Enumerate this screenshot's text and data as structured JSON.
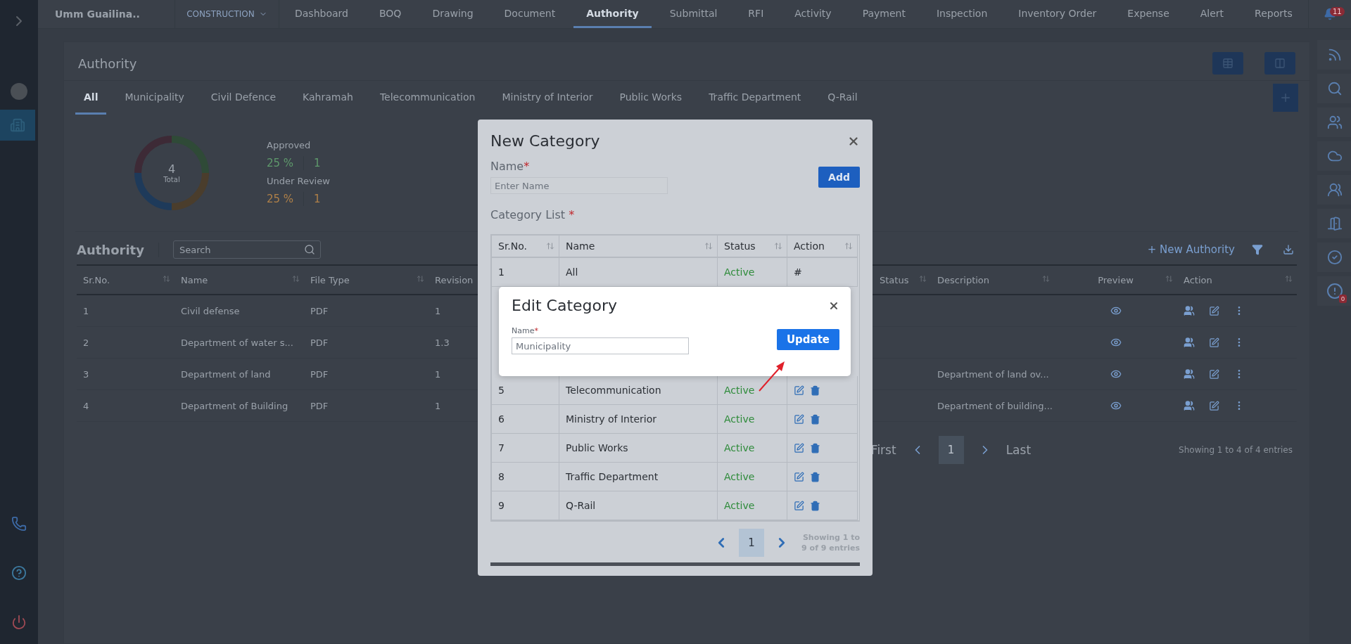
{
  "topbar": {
    "project": "Umm Guailina..",
    "module": "CONSTRUCTION",
    "nav": [
      {
        "label": "Dashboard",
        "selected": false
      },
      {
        "label": "BOQ",
        "selected": false
      },
      {
        "label": "Drawing",
        "selected": false
      },
      {
        "label": "Document",
        "selected": false
      },
      {
        "label": "Authority",
        "selected": true
      },
      {
        "label": "Submittal",
        "selected": false
      },
      {
        "label": "RFI",
        "selected": false
      },
      {
        "label": "Activity",
        "selected": false
      },
      {
        "label": "Payment",
        "selected": false
      },
      {
        "label": "Inspection",
        "selected": false
      },
      {
        "label": "Inventory Order",
        "selected": false
      },
      {
        "label": "Expense",
        "selected": false
      },
      {
        "label": "Alert",
        "selected": false
      },
      {
        "label": "Reports",
        "selected": false
      }
    ],
    "notifications": "11"
  },
  "page": {
    "title": "Authority",
    "tabs": [
      {
        "label": "All",
        "selected": true
      },
      {
        "label": "Municipality",
        "selected": false
      },
      {
        "label": "Civil Defence",
        "selected": false
      },
      {
        "label": "Kahramah",
        "selected": false
      },
      {
        "label": "Telecommunication",
        "selected": false
      },
      {
        "label": "Ministry of Interior",
        "selected": false
      },
      {
        "label": "Public Works",
        "selected": false
      },
      {
        "label": "Traffic Department",
        "selected": false
      },
      {
        "label": "Q-Rail",
        "selected": false
      }
    ]
  },
  "summary": {
    "total": "4",
    "total_label": "Total",
    "stats": [
      {
        "label": "Approved",
        "percent": "25 %",
        "count": "1",
        "color": "#5f9a6c"
      },
      {
        "label": "Under Review",
        "percent": "25 %",
        "count": "1",
        "color": "#b08048"
      }
    ]
  },
  "authority_table": {
    "title": "Authority",
    "search_placeholder": "Search",
    "new_button": "+ New Authority",
    "columns": [
      "Sr.No.",
      "Name",
      "File Type",
      "Revision",
      "Status",
      "Description",
      "Preview",
      "Action"
    ],
    "rows": [
      {
        "sr": "1",
        "name": "Civil defense",
        "file_type": "PDF",
        "revision": "1"
      },
      {
        "sr": "2",
        "name": "Department of water s...",
        "file_type": "PDF",
        "revision": "1.3"
      },
      {
        "sr": "3",
        "name": "Department of land",
        "file_type": "PDF",
        "revision": "1",
        "description": "Department of land ov..."
      },
      {
        "sr": "4",
        "name": "Department of Building",
        "file_type": "PDF",
        "revision": "1",
        "description": "Department of building..."
      }
    ]
  },
  "pagination": {
    "first": "First",
    "page": "1",
    "last": "Last",
    "info": "Showing 1 to 4 of 4 entries"
  },
  "right_rail": {
    "alerts_badge": "0"
  },
  "new_category": {
    "title": "New Category",
    "name_label": "Name",
    "required_mark": "*",
    "name_placeholder": "Enter Name",
    "add_button": "Add",
    "list_label": "Category List",
    "columns": [
      "Sr.No.",
      "Name",
      "Status",
      "Action"
    ],
    "rows": [
      {
        "kind": "fixed",
        "sr": "1",
        "name": "All",
        "status": "Active",
        "action": "#"
      },
      {
        "kind": "editable",
        "sr": "5",
        "name": "Telecommunication",
        "status": "Active"
      },
      {
        "kind": "editable",
        "sr": "6",
        "name": "Ministry of Interior",
        "status": "Active"
      },
      {
        "kind": "editable",
        "sr": "7",
        "name": "Public Works",
        "status": "Active"
      },
      {
        "kind": "editable",
        "sr": "8",
        "name": "Traffic Department",
        "status": "Active"
      },
      {
        "kind": "editable",
        "sr": "9",
        "name": "Q-Rail",
        "status": "Active"
      }
    ],
    "page": "1",
    "info": "Showing 1 to 9 of 9 entries"
  },
  "edit_category": {
    "title": "Edit Category",
    "name_label": "Name",
    "required_mark": "*",
    "name_placeholder": "Municipality",
    "button": "Update"
  }
}
